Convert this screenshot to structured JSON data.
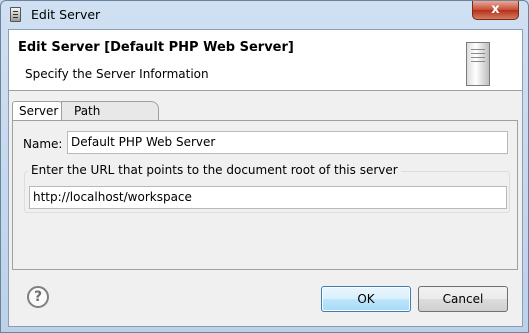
{
  "window": {
    "title": "Edit Server",
    "close_glyph": "x"
  },
  "header": {
    "title": "Edit Server [Default PHP Web Server]",
    "description": "Specify the Server Information",
    "icon": "server-icon"
  },
  "tabs": [
    {
      "label": "Server",
      "active": true
    },
    {
      "label": "Path Mapping",
      "active": false
    }
  ],
  "form": {
    "name_label": "Name:",
    "name_value": "Default PHP Web Server",
    "url_group_label": "Enter the URL that points to the document root of this server",
    "url_value": "http://localhost/workspace"
  },
  "buttons": {
    "help_glyph": "?",
    "ok_label": "OK",
    "cancel_label": "Cancel"
  },
  "colors": {
    "accent": "#3c7fb1",
    "close": "#c84b34"
  }
}
